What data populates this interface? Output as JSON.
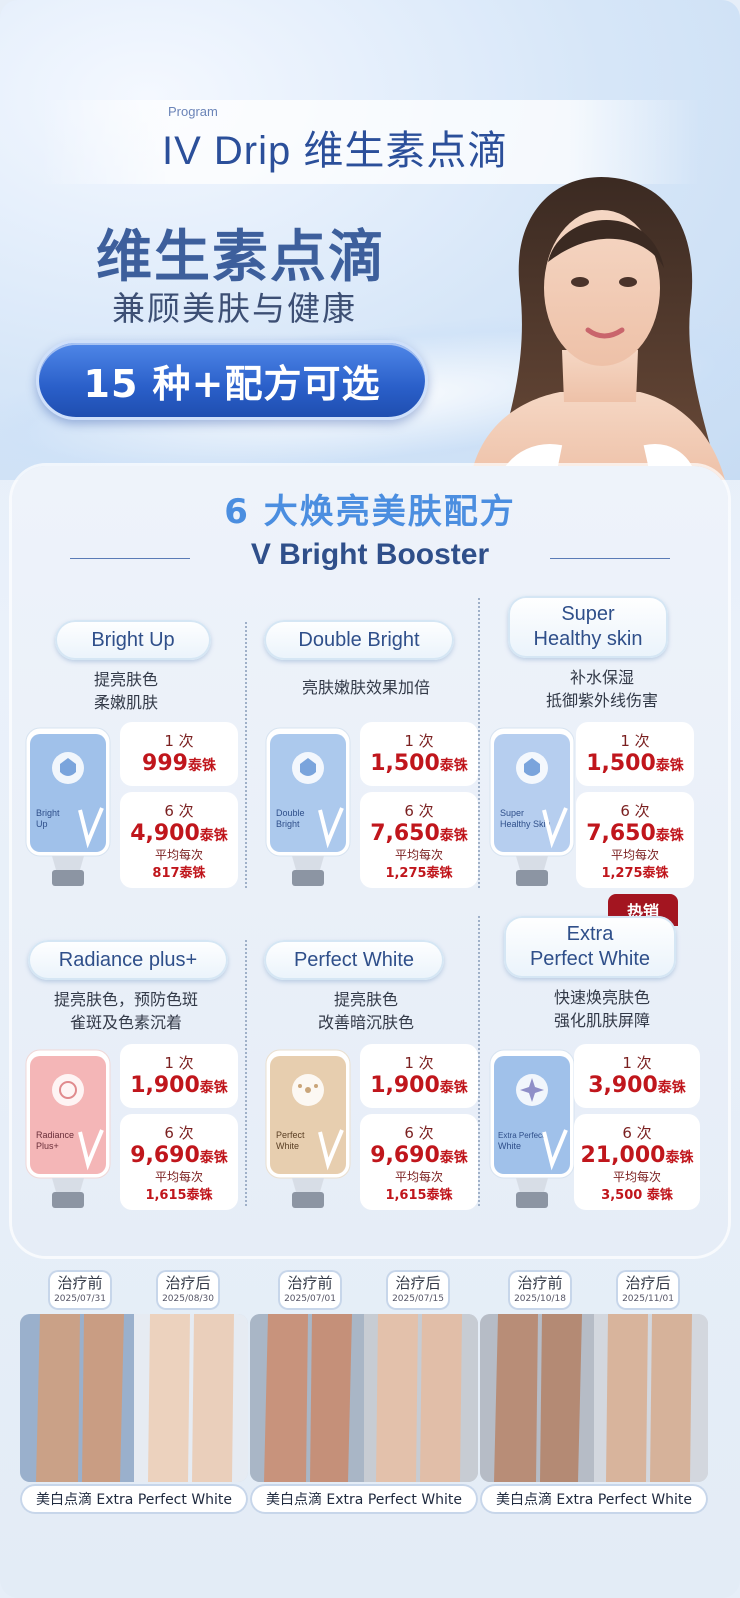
{
  "header": {
    "program_label": "Program",
    "program_title": "IV Drip 维生素点滴",
    "headline": "维生素点滴",
    "subheadline": "兼顾美肤与健康",
    "pill_text": "15 种+配方可选"
  },
  "section": {
    "title": "6 大焕亮美肤配方",
    "subtitle": "V Bright Booster"
  },
  "products": [
    {
      "name": "Bright Up",
      "desc_line1": "提亮肤色",
      "desc_line2": "柔嫩肌肤",
      "bottle_label_1": "Bright",
      "bottle_label_2": "Up",
      "once_label": "1 次",
      "once_price": "999",
      "six_label": "6 次",
      "six_price": "4,900",
      "currency": "泰铢",
      "avg_label": "平均每次",
      "avg_price": "817泰铢",
      "bottle_color": "#8fb6e6"
    },
    {
      "name": "Double Bright",
      "desc_line1": "亮肤嫩肤效果加倍",
      "desc_line2": "",
      "bottle_label_1": "Double",
      "bottle_label_2": "Bright",
      "once_label": "1 次",
      "once_price": "1,500",
      "six_label": "6 次",
      "six_price": "7,650",
      "currency": "泰铢",
      "avg_label": "平均每次",
      "avg_price": "1,275泰铢",
      "bottle_color": "#9ec0ea"
    },
    {
      "name_line1": "Super",
      "name_line2": "Healthy skin",
      "desc_line1": "补水保湿",
      "desc_line2": "抵御紫外线伤害",
      "bottle_label_1": "Super",
      "bottle_label_2": "Healthy Skin",
      "once_label": "1 次",
      "once_price": "1,500",
      "six_label": "6 次",
      "six_price": "7,650",
      "currency": "泰铢",
      "avg_label": "平均每次",
      "avg_price": "1,275泰铢",
      "bottle_color": "#a9c6ec"
    },
    {
      "name": "Radiance plus+",
      "desc_line1": "提亮肤色，预防色斑",
      "desc_line2": "雀斑及色素沉着",
      "bottle_label_1": "Radiance",
      "bottle_label_2": "Plus+",
      "once_label": "1 次",
      "once_price": "1,900",
      "six_label": "6 次",
      "six_price": "9,690",
      "currency": "泰铢",
      "avg_label": "平均每次",
      "avg_price": "1,615泰铢",
      "bottle_color": "#f2a9aa"
    },
    {
      "name": "Perfect White",
      "desc_line1": "提亮肤色",
      "desc_line2": "改善暗沉肤色",
      "bottle_label_1": "Perfect",
      "bottle_label_2": "White",
      "once_label": "1 次",
      "once_price": "1,900",
      "six_label": "6 次",
      "six_price": "9,690",
      "currency": "泰铢",
      "avg_label": "平均每次",
      "avg_price": "1,615泰铢",
      "bottle_color": "#e4c9a6"
    },
    {
      "name_line1": "Extra",
      "name_line2": "Perfect White",
      "desc_line1": "快速焕亮肤色",
      "desc_line2": "强化肌肤屏障",
      "bottle_label_1": "Extra Perfect",
      "bottle_label_2": "White",
      "once_label": "1 次",
      "once_price": "3,900",
      "six_label": "6 次",
      "six_price": "21,000",
      "currency": "泰铢",
      "avg_label": "平均每次",
      "avg_price": "3,500 泰铢",
      "bottle_color": "#8fb6e6",
      "hot_tag": "热销"
    }
  ],
  "cases": [
    {
      "before_label": "治疗前",
      "before_date": "2025/07/31",
      "after_label": "治疗后",
      "after_date": "2025/08/30",
      "caption": "美白点滴 Extra Perfect White"
    },
    {
      "before_label": "治疗前",
      "before_date": "2025/07/01",
      "after_label": "治疗后",
      "after_date": "2025/07/15",
      "caption": "美白点滴 Extra Perfect White"
    },
    {
      "before_label": "治疗前",
      "before_date": "2025/10/18",
      "after_label": "治疗后",
      "after_date": "2025/11/01",
      "caption": "美白点滴 Extra Perfect White"
    }
  ],
  "colors": {
    "brand_blue": "#2b4f9a",
    "accent_blue": "#4b8ee0",
    "price_red": "#c0161c",
    "hot_red": "#a31520"
  }
}
